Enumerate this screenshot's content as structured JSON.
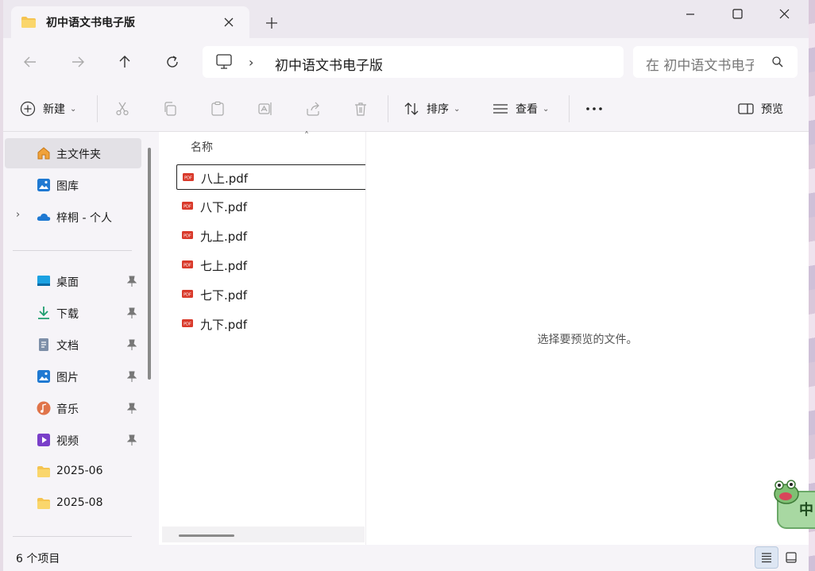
{
  "window": {
    "tab_title": "初中语文书电子版"
  },
  "address": {
    "crumb": "初中语文书电子版",
    "search_placeholder": "在 初中语文书电子版中搜索"
  },
  "toolbar": {
    "new_label": "新建",
    "sort_label": "排序",
    "view_label": "查看",
    "preview_label": "预览"
  },
  "sidebar": {
    "items": [
      {
        "label": "主文件夹",
        "icon": "home-icon"
      },
      {
        "label": "图库",
        "icon": "gallery-icon"
      },
      {
        "label": "梓桐 - 个人",
        "icon": "onedrive-icon"
      },
      {
        "label": "桌面",
        "icon": "desktop-icon"
      },
      {
        "label": "下载",
        "icon": "download-icon"
      },
      {
        "label": "文档",
        "icon": "document-icon"
      },
      {
        "label": "图片",
        "icon": "pictures-icon"
      },
      {
        "label": "音乐",
        "icon": "music-icon"
      },
      {
        "label": "视频",
        "icon": "video-icon"
      },
      {
        "label": "2025-06",
        "icon": "folder-icon"
      },
      {
        "label": "2025-08",
        "icon": "folder-icon"
      }
    ]
  },
  "filelist": {
    "column_name": "名称",
    "files": [
      "八上.pdf",
      "八下.pdf",
      "九上.pdf",
      "七上.pdf",
      "七下.pdf",
      "九下.pdf"
    ]
  },
  "preview": {
    "message": "选择要预览的文件。"
  },
  "status": {
    "count": "6 个项目"
  },
  "ime": {
    "char": "中"
  },
  "colors": {
    "accent": "#0067c0",
    "folder": "#f5c451",
    "pdf": "#d93a2b"
  }
}
